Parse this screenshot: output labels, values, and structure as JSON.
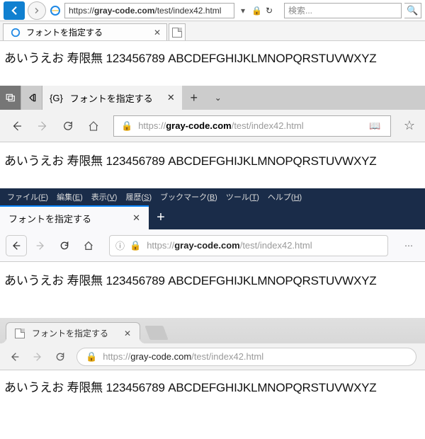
{
  "page_text": "あいうえお 寿限無 123456789 ABCDEFGHIJKLMNOPQRSTUVWXYZ",
  "url": {
    "prefix": "https://",
    "domain": "gray-code.com",
    "path": "/test/index42.html"
  },
  "ie": {
    "tab_title": "フォントを指定する",
    "search_placeholder": "検索..."
  },
  "edge": {
    "tab_prefix": "{G}",
    "tab_title": "フォントを指定する"
  },
  "firefox": {
    "tab_title": "フォントを指定する",
    "menu": {
      "file": {
        "label": "ファイル",
        "key": "F"
      },
      "edit": {
        "label": "編集",
        "key": "E"
      },
      "view": {
        "label": "表示",
        "key": "V"
      },
      "history": {
        "label": "履歴",
        "key": "S"
      },
      "bookmarks": {
        "label": "ブックマーク",
        "key": "B"
      },
      "tools": {
        "label": "ツール",
        "key": "T"
      },
      "help": {
        "label": "ヘルプ",
        "key": "H"
      }
    }
  },
  "chrome": {
    "tab_title": "フォントを指定する"
  }
}
